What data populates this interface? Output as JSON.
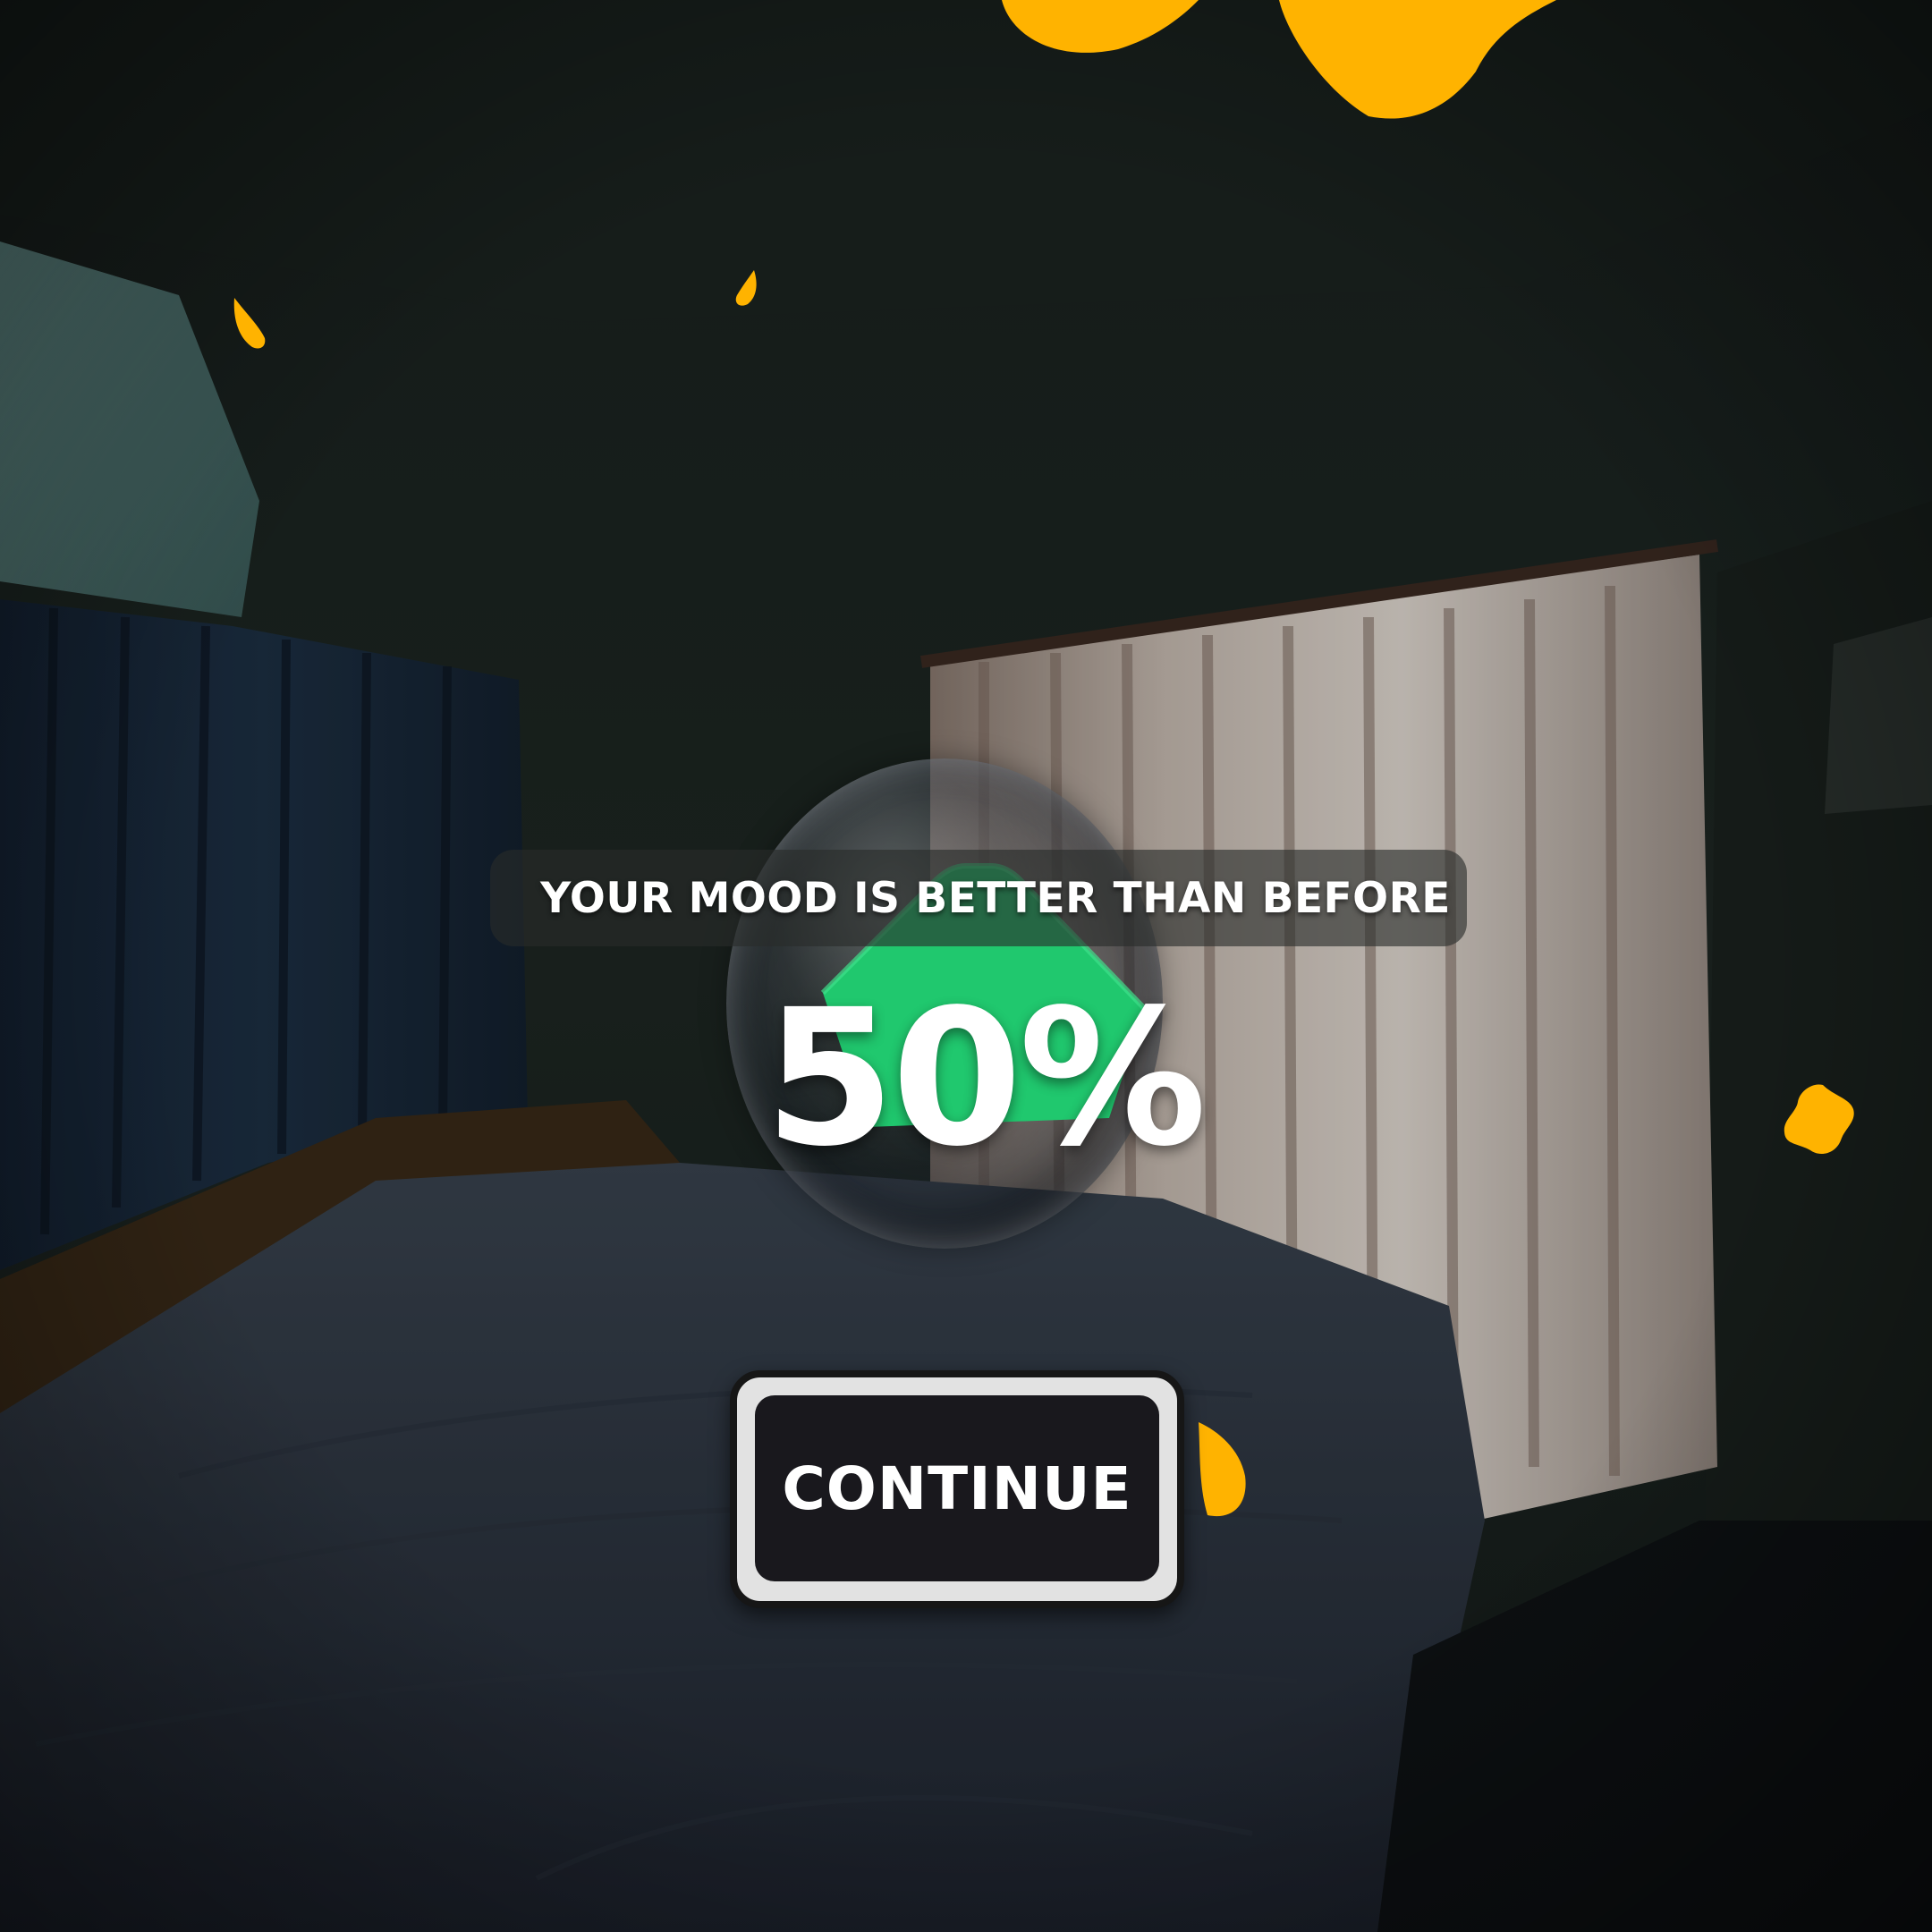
{
  "mood_result": {
    "message": "YOUR MOOD IS BETTER THAN BEFORE",
    "percent_label": "50%",
    "fill_level": 0.5
  },
  "actions": {
    "continue_label": "CONTINUE"
  },
  "colors": {
    "accent_green": "#20c86e",
    "petal_yellow": "#ffb300",
    "button_face": "#19181d",
    "button_rim": "#e2e2e2"
  }
}
